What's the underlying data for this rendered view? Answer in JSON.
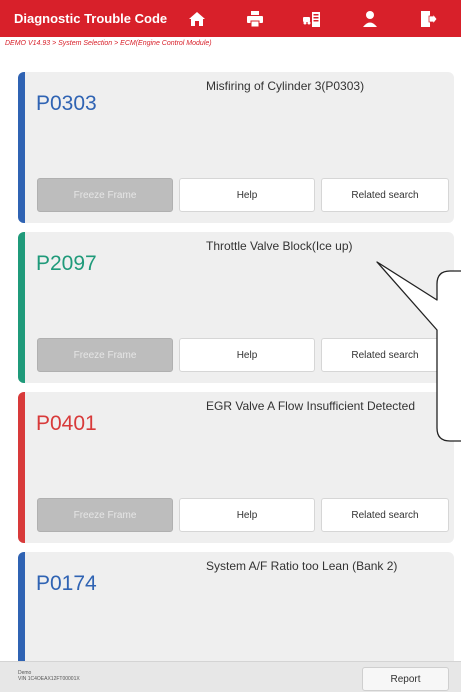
{
  "header": {
    "title": "Diagnostic Trouble Code",
    "icons": [
      "home-icon",
      "print-icon",
      "vehicle-list-icon",
      "user-icon",
      "exit-icon"
    ]
  },
  "breadcrumb": "DEMO V14.93 > System Selection > ECM(Engine Control Module)",
  "codes": [
    {
      "code": "P0303",
      "description": "Misfiring of Cylinder 3(P0303)",
      "color": "#2f63b3"
    },
    {
      "code": "P2097",
      "description": "Throttle Valve Block(Ice up)",
      "color": "#1f9a7a"
    },
    {
      "code": "P0401",
      "description": "EGR Valve A Flow Insufficient Detected",
      "color": "#d83a3a"
    },
    {
      "code": "P0174",
      "description": "System A/F Ratio too Lean (Bank 2)",
      "color": "#2f63b3"
    }
  ],
  "buttons": {
    "freeze": "Freeze Frame",
    "help": "Help",
    "related": "Related search"
  },
  "footer": {
    "make": "Demo",
    "vin": "VIN 1C4OEAX12FT00001X",
    "report": "Report"
  },
  "colors": {
    "accent": "#d8202a",
    "card_bg": "#efefef"
  }
}
